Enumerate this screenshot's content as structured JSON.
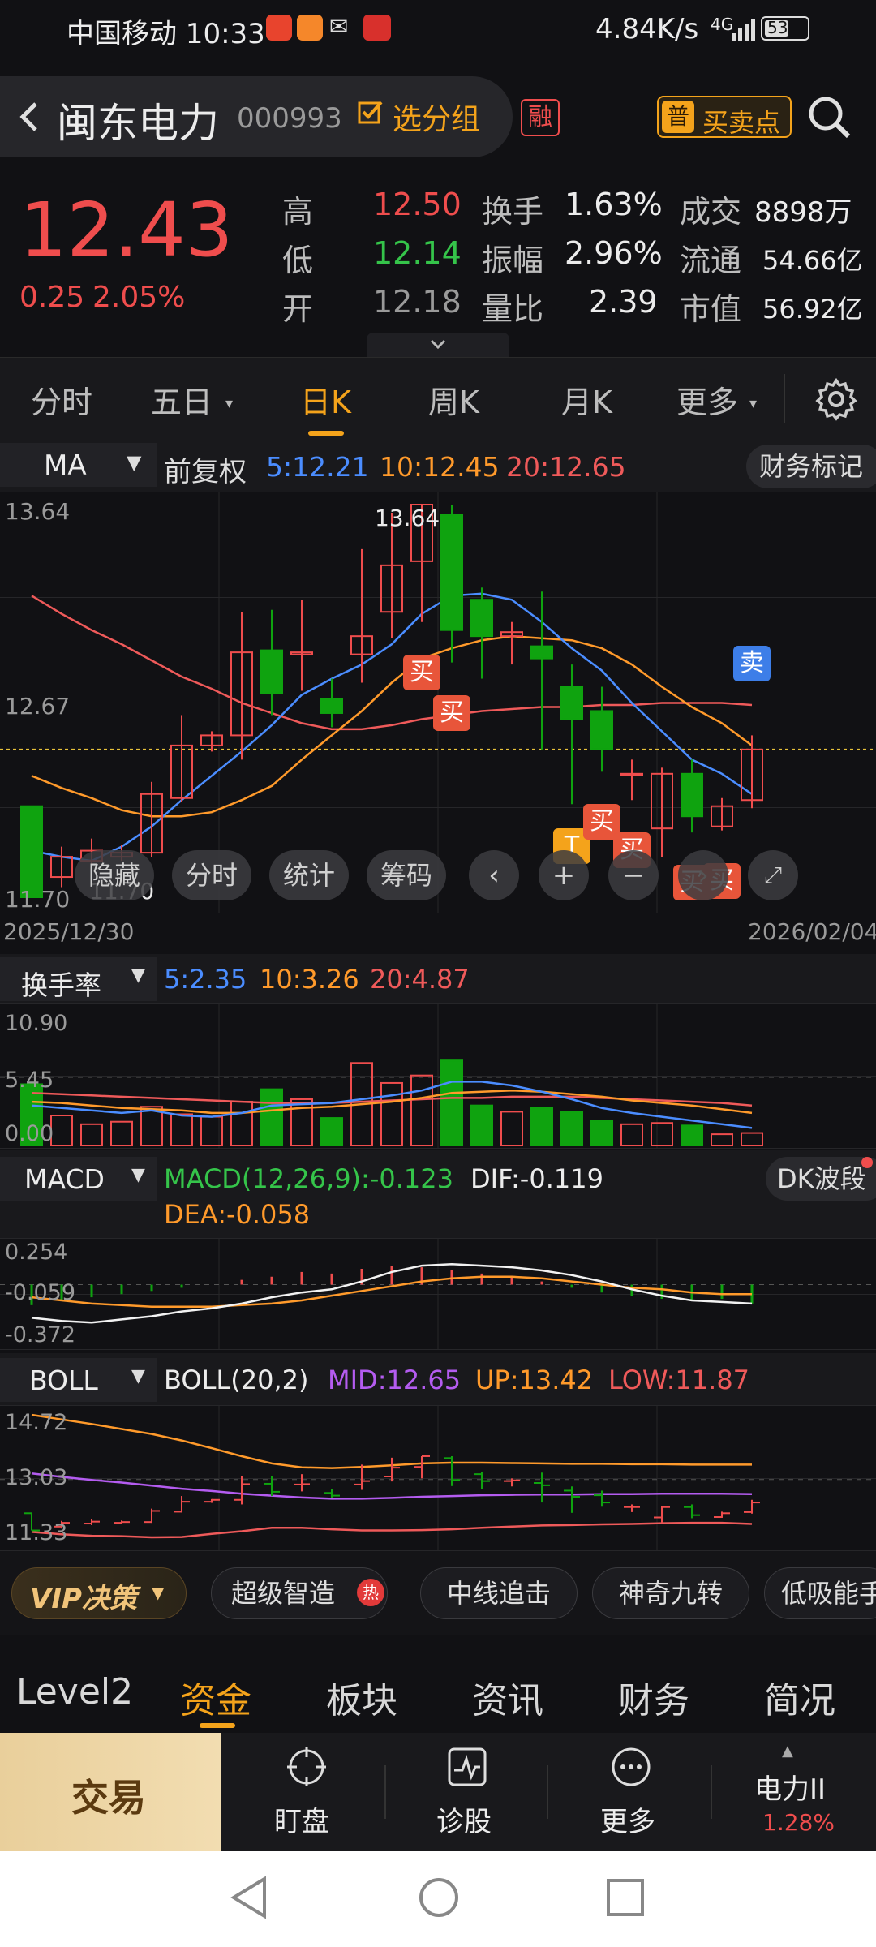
{
  "status": {
    "carrier_time": "中国移动 10:33",
    "net_speed": "4.84K/s",
    "signal": "4G",
    "battery": "53"
  },
  "header": {
    "name": "闽东电力",
    "code": "000993",
    "group_label": "选分组",
    "margin_badge": "融",
    "buysell_badge": "普",
    "buysell_label": "买卖点"
  },
  "quote": {
    "price": "12.43",
    "change": "0.25",
    "change_pct": "2.05%",
    "high_label": "高",
    "high": "12.50",
    "low_label": "低",
    "low": "12.14",
    "open_label": "开",
    "open": "12.18",
    "turnover_label": "换手",
    "turnover": "1.63%",
    "amplitude_label": "振幅",
    "amplitude": "2.96%",
    "vol_ratio_label": "量比",
    "vol_ratio": "2.39",
    "deal_label": "成交",
    "deal": "8898万",
    "float_label": "流通",
    "float": "54.66亿",
    "mktcap_label": "市值",
    "mktcap": "56.92亿"
  },
  "tabs": [
    "分时",
    "五日",
    "日K",
    "周K",
    "月K",
    "更多"
  ],
  "active_tab": "日K",
  "ma": {
    "label": "MA",
    "adjust": "前复权",
    "ma5": "5:12.21",
    "ma10": "10:12.45",
    "ma20": "20:12.65",
    "finance_mark": "财务标记",
    "y_top": "13.64",
    "y_mid": "12.67",
    "y_bot": "11.70",
    "max_label": "13.64",
    "min_label": "11.70",
    "date_start": "2025/12/30",
    "date_end": "2026/02/04"
  },
  "overlay_buttons": [
    "隐藏",
    "分时",
    "统计",
    "筹码"
  ],
  "signals": {
    "buy": "买",
    "sell": "卖",
    "t": "T"
  },
  "turnover": {
    "label": "换手率",
    "v5": "5:2.35",
    "v10": "10:3.26",
    "v20": "20:4.87",
    "y_top": "10.90",
    "y_mid": "5.45",
    "y_bot": "0.00"
  },
  "macd": {
    "label": "MACD",
    "title": "MACD(12,26,9):-0.123",
    "dif": "DIF:-0.119",
    "dea": "DEA:-0.058",
    "dk": "DK波段",
    "y_top": "0.254",
    "y_mid": "-0.059",
    "y_bot": "-0.372"
  },
  "boll": {
    "label": "BOLL",
    "title": "BOLL(20,2)",
    "mid": "MID:12.65",
    "up": "UP:13.42",
    "low": "LOW:11.87",
    "y_top": "14.72",
    "y_mid": "13.03",
    "y_bot": "11.33"
  },
  "strategies": {
    "vip": "VIP决策",
    "items": [
      "超级智造",
      "中线追击",
      "神奇九转",
      "低吸能手"
    ],
    "hot": "热"
  },
  "bottom_tabs": [
    "Level2",
    "资金",
    "板块",
    "资讯",
    "财务",
    "简况"
  ],
  "active_bottom_tab": "资金",
  "bottom_bar": {
    "trade": "交易",
    "watch": "盯盘",
    "diagnose": "诊股",
    "more": "更多",
    "sector_name": "电力II",
    "sector_pct": "1.28%"
  },
  "colors": {
    "up": "#ef4d4d",
    "down": "#0fa30f",
    "ma5": "#4b8dff",
    "ma10": "#ff9a2b",
    "ma20": "#ef5a5a",
    "accent": "#f4a31b",
    "boll_mid": "#b45cf0"
  },
  "chart_data": {
    "type": "candlestick",
    "candles": [
      {
        "o": 12.15,
        "c": 11.7,
        "h": 12.15,
        "l": 11.7
      },
      {
        "o": 11.8,
        "c": 11.9,
        "h": 11.95,
        "l": 11.75
      },
      {
        "o": 11.88,
        "c": 11.93,
        "h": 11.99,
        "l": 11.84
      },
      {
        "o": 11.9,
        "c": 11.92,
        "h": 11.96,
        "l": 11.88
      },
      {
        "o": 11.92,
        "c": 12.21,
        "h": 12.27,
        "l": 11.9
      },
      {
        "o": 12.19,
        "c": 12.45,
        "h": 12.6,
        "l": 12.17
      },
      {
        "o": 12.45,
        "c": 12.5,
        "h": 12.52,
        "l": 12.42
      },
      {
        "o": 12.5,
        "c": 12.91,
        "h": 13.11,
        "l": 12.38
      },
      {
        "o": 12.92,
        "c": 12.71,
        "h": 13.12,
        "l": 12.6
      },
      {
        "o": 12.9,
        "c": 12.91,
        "h": 13.17,
        "l": 12.72
      },
      {
        "o": 12.68,
        "c": 12.61,
        "h": 12.78,
        "l": 12.54
      },
      {
        "o": 12.9,
        "c": 12.99,
        "h": 13.42,
        "l": 12.76
      },
      {
        "o": 13.11,
        "c": 13.34,
        "h": 13.6,
        "l": 12.98
      },
      {
        "o": 13.36,
        "c": 13.64,
        "h": 13.64,
        "l": 13.06
      },
      {
        "o": 13.59,
        "c": 13.02,
        "h": 13.64,
        "l": 12.86
      },
      {
        "o": 13.17,
        "c": 12.99,
        "h": 13.23,
        "l": 12.78
      },
      {
        "o": 12.99,
        "c": 13.01,
        "h": 13.06,
        "l": 12.85
      },
      {
        "o": 12.94,
        "c": 12.88,
        "h": 13.21,
        "l": 12.43
      },
      {
        "o": 12.74,
        "c": 12.58,
        "h": 12.85,
        "l": 12.16
      },
      {
        "o": 12.62,
        "c": 12.43,
        "h": 12.74,
        "l": 12.32
      },
      {
        "o": 12.31,
        "c": 12.31,
        "h": 12.38,
        "l": 12.18
      },
      {
        "o": 12.04,
        "c": 12.31,
        "h": 12.34,
        "l": 11.9
      },
      {
        "o": 12.31,
        "c": 12.1,
        "h": 12.38,
        "l": 12.02
      },
      {
        "o": 12.05,
        "c": 12.15,
        "h": 12.19,
        "l": 12.03
      },
      {
        "o": 12.18,
        "c": 12.43,
        "h": 12.5,
        "l": 12.14
      }
    ],
    "ma5": [
      11.93,
      11.9,
      11.88,
      11.95,
      12.05,
      12.18,
      12.3,
      12.42,
      12.55,
      12.7,
      12.78,
      12.85,
      12.95,
      13.1,
      13.19,
      13.2,
      13.17,
      13.06,
      12.93,
      12.82,
      12.66,
      12.52,
      12.38,
      12.31,
      12.21
    ],
    "ma10": [
      12.3,
      12.24,
      12.19,
      12.13,
      12.1,
      12.1,
      12.12,
      12.18,
      12.25,
      12.38,
      12.5,
      12.62,
      12.76,
      12.88,
      12.93,
      12.97,
      12.99,
      12.98,
      12.97,
      12.93,
      12.85,
      12.74,
      12.64,
      12.56,
      12.45
    ],
    "ma20": [
      13.19,
      13.1,
      13.02,
      12.95,
      12.87,
      12.79,
      12.73,
      12.66,
      12.61,
      12.56,
      12.53,
      12.53,
      12.55,
      12.58,
      12.6,
      12.62,
      12.63,
      12.64,
      12.64,
      12.65,
      12.65,
      12.66,
      12.66,
      12.66,
      12.65
    ],
    "turnover": [
      4.9,
      2.4,
      1.7,
      1.9,
      3.1,
      2.5,
      2.3,
      3.5,
      4.5,
      3.7,
      2.2,
      6.6,
      5.0,
      5.6,
      6.8,
      3.2,
      2.7,
      3.0,
      2.7,
      2.0,
      1.7,
      1.8,
      1.6,
      0.9,
      1.0
    ],
    "turnover_ma5": [
      3.2,
      3.0,
      2.8,
      2.6,
      2.8,
      2.4,
      2.3,
      2.6,
      3.2,
      3.3,
      3.4,
      3.7,
      4.0,
      4.4,
      5.1,
      5.1,
      4.8,
      4.3,
      3.7,
      3.0,
      2.6,
      2.3,
      2.0,
      1.7,
      1.4
    ],
    "turnover_ma10": [
      3.5,
      3.4,
      3.2,
      3.0,
      2.9,
      2.8,
      2.6,
      2.6,
      2.8,
      3.0,
      3.1,
      3.3,
      3.5,
      3.8,
      4.2,
      4.3,
      4.4,
      4.3,
      4.1,
      3.9,
      3.6,
      3.4,
      3.2,
      2.9,
      2.6
    ],
    "turnover_ma20": [
      4.2,
      4.1,
      4.0,
      3.9,
      3.8,
      3.7,
      3.6,
      3.5,
      3.4,
      3.4,
      3.4,
      3.5,
      3.6,
      3.7,
      3.8,
      3.8,
      3.9,
      3.9,
      3.9,
      3.8,
      3.7,
      3.6,
      3.5,
      3.4,
      3.2
    ],
    "turnover_ylim": [
      0,
      10.9
    ],
    "macd_hist": [
      -0.13,
      -0.1,
      -0.08,
      -0.06,
      -0.04,
      -0.02,
      0.0,
      0.03,
      0.05,
      0.08,
      0.07,
      0.1,
      0.12,
      0.11,
      0.09,
      0.07,
      0.05,
      0.02,
      -0.02,
      -0.05,
      -0.07,
      -0.09,
      -0.1,
      -0.09,
      -0.12
    ],
    "macd_dif": [
      -0.21,
      -0.23,
      -0.24,
      -0.22,
      -0.2,
      -0.17,
      -0.15,
      -0.12,
      -0.08,
      -0.05,
      -0.03,
      0.02,
      0.08,
      0.12,
      0.13,
      0.12,
      0.11,
      0.09,
      0.06,
      0.02,
      -0.03,
      -0.07,
      -0.1,
      -0.11,
      -0.12
    ],
    "macd_dea": [
      -0.08,
      -0.1,
      -0.12,
      -0.13,
      -0.14,
      -0.14,
      -0.14,
      -0.13,
      -0.12,
      -0.1,
      -0.07,
      -0.04,
      -0.01,
      0.02,
      0.04,
      0.05,
      0.05,
      0.04,
      0.02,
      0.0,
      -0.02,
      -0.03,
      -0.05,
      -0.06,
      -0.06
    ],
    "macd_ylim": [
      -0.372,
      0.254
    ],
    "boll_up": [
      14.72,
      14.6,
      14.48,
      14.35,
      14.22,
      14.05,
      13.85,
      13.64,
      13.45,
      13.35,
      13.33,
      13.36,
      13.4,
      13.45,
      13.47,
      13.47,
      13.46,
      13.45,
      13.44,
      13.44,
      13.43,
      13.43,
      13.42,
      13.42,
      13.42
    ],
    "boll_mid": [
      13.19,
      13.1,
      13.02,
      12.95,
      12.87,
      12.79,
      12.73,
      12.66,
      12.61,
      12.56,
      12.53,
      12.53,
      12.55,
      12.58,
      12.6,
      12.62,
      12.63,
      12.64,
      12.64,
      12.65,
      12.65,
      12.66,
      12.66,
      12.66,
      12.65
    ],
    "boll_low": [
      11.66,
      11.6,
      11.56,
      11.55,
      11.52,
      11.53,
      11.61,
      11.68,
      11.77,
      11.77,
      11.73,
      11.7,
      11.7,
      11.71,
      11.73,
      11.77,
      11.8,
      11.83,
      11.84,
      11.86,
      11.87,
      11.89,
      11.9,
      11.9,
      11.87
    ],
    "boll_ylim": [
      11.33,
      14.72
    ],
    "price_ylim": [
      11.7,
      13.64
    ],
    "signal_marks": [
      {
        "type": "buy",
        "index": 13
      },
      {
        "type": "buy",
        "index": 14
      },
      {
        "type": "T",
        "index": 18
      },
      {
        "type": "buy",
        "index": 19
      },
      {
        "type": "buy",
        "index": 20
      },
      {
        "type": "buy",
        "index": 22
      },
      {
        "type": "buy",
        "index": 23
      },
      {
        "type": "sell",
        "index": 26
      }
    ],
    "x_range": [
      "2025/12/30",
      "2026/02/04"
    ]
  }
}
